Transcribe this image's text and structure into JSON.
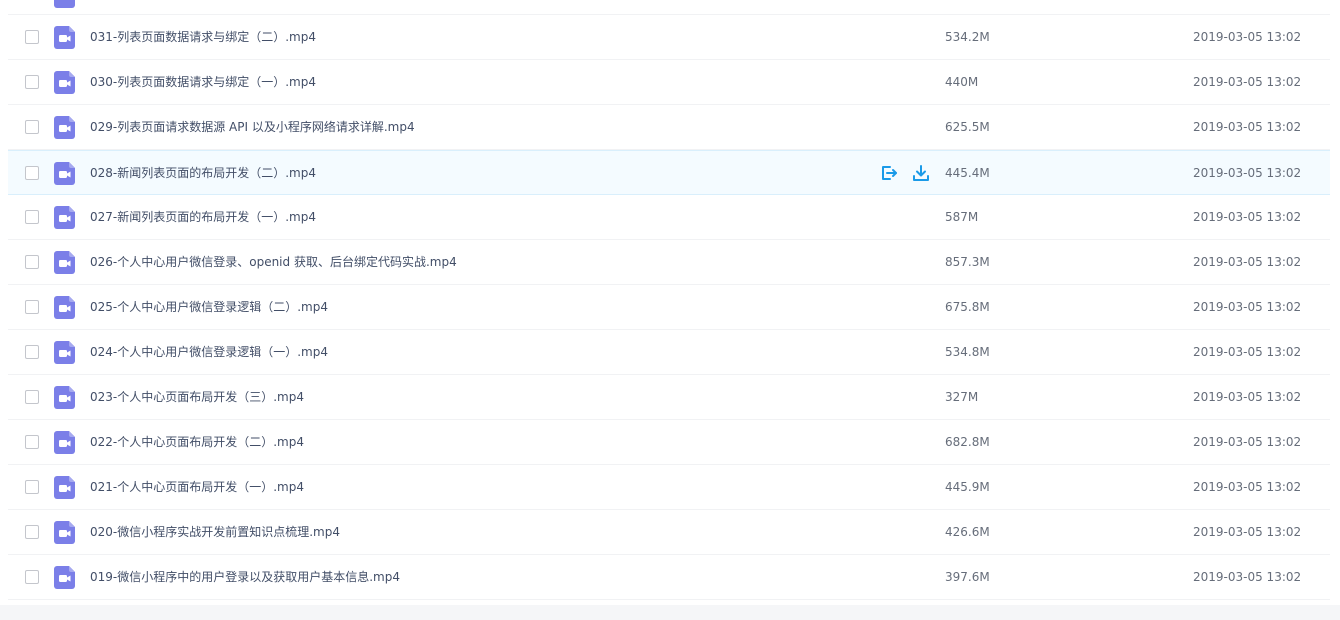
{
  "icons": {
    "file_icon": "video-file-icon",
    "share_icon": "share-icon",
    "download_icon": "download-icon"
  },
  "colors": {
    "file_icon_bg": "#7b7fe8",
    "action_icon": "#1a9ae8",
    "hover_row_bg": "#f4fbff"
  },
  "files": [
    {
      "name": "031-列表页面数据请求与绑定（二）.mp4",
      "size": "534.2M",
      "date": "2019-03-05 13:02"
    },
    {
      "name": "030-列表页面数据请求与绑定（一）.mp4",
      "size": "440M",
      "date": "2019-03-05 13:02"
    },
    {
      "name": "029-列表页面请求数据源 API 以及小程序网络请求详解.mp4",
      "size": "625.5M",
      "date": "2019-03-05 13:02"
    },
    {
      "name": "028-新闻列表页面的布局开发（二）.mp4",
      "size": "445.4M",
      "date": "2019-03-05 13:02"
    },
    {
      "name": "027-新闻列表页面的布局开发（一）.mp4",
      "size": "587M",
      "date": "2019-03-05 13:02"
    },
    {
      "name": "026-个人中心用户微信登录、openid 获取、后台绑定代码实战.mp4",
      "size": "857.3M",
      "date": "2019-03-05 13:02"
    },
    {
      "name": "025-个人中心用户微信登录逻辑（二）.mp4",
      "size": "675.8M",
      "date": "2019-03-05 13:02"
    },
    {
      "name": "024-个人中心用户微信登录逻辑（一）.mp4",
      "size": "534.8M",
      "date": "2019-03-05 13:02"
    },
    {
      "name": "023-个人中心页面布局开发（三）.mp4",
      "size": "327M",
      "date": "2019-03-05 13:02"
    },
    {
      "name": "022-个人中心页面布局开发（二）.mp4",
      "size": "682.8M",
      "date": "2019-03-05 13:02"
    },
    {
      "name": "021-个人中心页面布局开发（一）.mp4",
      "size": "445.9M",
      "date": "2019-03-05 13:02"
    },
    {
      "name": "020-微信小程序实战开发前置知识点梳理.mp4",
      "size": "426.6M",
      "date": "2019-03-05 13:02"
    },
    {
      "name": "019-微信小程序中的用户登录以及获取用户基本信息.mp4",
      "size": "397.6M",
      "date": "2019-03-05 13:02"
    }
  ]
}
